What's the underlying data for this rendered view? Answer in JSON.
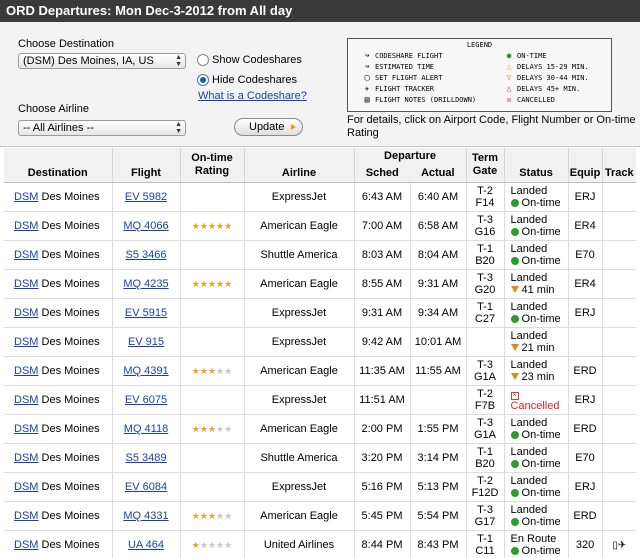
{
  "title": "ORD Departures: Mon Dec-3-2012 from All day",
  "controls": {
    "destination_label": "Choose Destination",
    "destination_value": "(DSM) Des Moines, IA, US",
    "airline_label": "Choose Airline",
    "airline_value": "-- All Airlines --",
    "show_codeshares": "Show Codeshares",
    "hide_codeshares": "Hide Codeshares",
    "codeshare_link": "What is a Codeshare?",
    "update_label": "Update",
    "note": "For details, click on Airport Code, Flight Number or On-time Rating"
  },
  "legend": {
    "title": "LEGEND",
    "items": [
      {
        "symbol": "↝",
        "label": "CODESHARE FLIGHT"
      },
      {
        "symbol": "↝",
        "label": "ESTIMATED TIME"
      },
      {
        "symbol": "▢",
        "label": "SET FLIGHT ALERT"
      },
      {
        "symbol": "✈",
        "label": "FLIGHT TRACKER"
      },
      {
        "symbol": "▤",
        "label": "FLIGHT NOTES (DRILLDOWN)"
      },
      {
        "symbol": "●",
        "label": "ON-TIME"
      },
      {
        "symbol": "△",
        "label": "DELAYS 15-29 MIN."
      },
      {
        "symbol": "▽",
        "label": "DELAYS 30-44 MIN."
      },
      {
        "symbol": "△",
        "label": "DELAYS 45+ MIN."
      },
      {
        "symbol": "☒",
        "label": "CANCELLED"
      }
    ]
  },
  "table": {
    "headers": {
      "destination": "Destination",
      "flight": "Flight",
      "ontime": "On-time Rating",
      "airline": "Airline",
      "departure": "Departure",
      "sched": "Sched",
      "actual": "Actual",
      "term_gate": "Term Gate",
      "status": "Status",
      "equip": "Equip",
      "track": "Track"
    },
    "rows": [
      {
        "code": "DSM",
        "city": "Des Moines",
        "flight": "EV 5982",
        "rating": 0,
        "airline": "ExpressJet",
        "sched": "6:43 AM",
        "actual": "6:40 AM",
        "term": "T-2",
        "gate": "F14",
        "status1": "Landed",
        "status2": "On-time",
        "kind": "ontime",
        "equip": "ERJ",
        "track": ""
      },
      {
        "code": "DSM",
        "city": "Des Moines",
        "flight": "MQ 4066",
        "rating": 5,
        "airline": "American Eagle",
        "sched": "7:00 AM",
        "actual": "6:58 AM",
        "term": "T-3",
        "gate": "G16",
        "status1": "Landed",
        "status2": "On-time",
        "kind": "ontime",
        "equip": "ER4",
        "track": ""
      },
      {
        "code": "DSM",
        "city": "Des Moines",
        "flight": "S5 3466",
        "rating": 0,
        "airline": "Shuttle America",
        "sched": "8:03 AM",
        "actual": "8:04 AM",
        "term": "T-1",
        "gate": "B20",
        "status1": "Landed",
        "status2": "On-time",
        "kind": "ontime",
        "equip": "E70",
        "track": ""
      },
      {
        "code": "DSM",
        "city": "Des Moines",
        "flight": "MQ 4235",
        "rating": 5,
        "airline": "American Eagle",
        "sched": "8:55 AM",
        "actual": "9:31 AM",
        "term": "T-3",
        "gate": "G20",
        "status1": "Landed",
        "status2": "41 min",
        "kind": "delay",
        "equip": "ER4",
        "track": ""
      },
      {
        "code": "DSM",
        "city": "Des Moines",
        "flight": "EV 5915",
        "rating": 0,
        "airline": "ExpressJet",
        "sched": "9:31 AM",
        "actual": "9:34 AM",
        "term": "T-1",
        "gate": "C27",
        "status1": "Landed",
        "status2": "On-time",
        "kind": "ontime",
        "equip": "ERJ",
        "track": ""
      },
      {
        "code": "DSM",
        "city": "Des Moines",
        "flight": "EV 915",
        "rating": 0,
        "airline": "ExpressJet",
        "sched": "9:42 AM",
        "actual": "10:01 AM",
        "term": "",
        "gate": "",
        "status1": "Landed",
        "status2": "21 min",
        "kind": "delay",
        "equip": "",
        "track": ""
      },
      {
        "code": "DSM",
        "city": "Des Moines",
        "flight": "MQ 4391",
        "rating": 3,
        "airline": "American Eagle",
        "sched": "11:35 AM",
        "actual": "11:55 AM",
        "term": "T-3",
        "gate": "G1A",
        "status1": "Landed",
        "status2": "23 min",
        "kind": "delay",
        "equip": "ERD",
        "track": ""
      },
      {
        "code": "DSM",
        "city": "Des Moines",
        "flight": "EV 6075",
        "rating": 0,
        "airline": "ExpressJet",
        "sched": "11:51 AM",
        "actual": "",
        "term": "T-2",
        "gate": "F7B",
        "status1": "Cancelled",
        "status2": "",
        "kind": "cancelled",
        "equip": "ERJ",
        "track": ""
      },
      {
        "code": "DSM",
        "city": "Des Moines",
        "flight": "MQ 4118",
        "rating": 3,
        "airline": "American Eagle",
        "sched": "2:00 PM",
        "actual": "1:55 PM",
        "term": "T-3",
        "gate": "G1A",
        "status1": "Landed",
        "status2": "On-time",
        "kind": "ontime",
        "equip": "ERD",
        "track": ""
      },
      {
        "code": "DSM",
        "city": "Des Moines",
        "flight": "S5 3489",
        "rating": 0,
        "airline": "Shuttle America",
        "sched": "3:20 PM",
        "actual": "3:14 PM",
        "term": "T-1",
        "gate": "B20",
        "status1": "Landed",
        "status2": "On-time",
        "kind": "ontime",
        "equip": "E70",
        "track": ""
      },
      {
        "code": "DSM",
        "city": "Des Moines",
        "flight": "EV 6084",
        "rating": 0,
        "airline": "ExpressJet",
        "sched": "5:16 PM",
        "actual": "5:13 PM",
        "term": "T-2",
        "gate": "F12D",
        "status1": "Landed",
        "status2": "On-time",
        "kind": "ontime",
        "equip": "ERJ",
        "track": ""
      },
      {
        "code": "DSM",
        "city": "Des Moines",
        "flight": "MQ 4331",
        "rating": 3,
        "airline": "American Eagle",
        "sched": "5:45 PM",
        "actual": "5:54 PM",
        "term": "T-3",
        "gate": "G17",
        "status1": "Landed",
        "status2": "On-time",
        "kind": "ontime",
        "equip": "ERD",
        "track": ""
      },
      {
        "code": "DSM",
        "city": "Des Moines",
        "flight": "UA 464",
        "rating": 1,
        "airline": "United Airlines",
        "sched": "8:44 PM",
        "actual": "8:43 PM",
        "term": "T-1",
        "gate": "C11",
        "status1": "En Route",
        "status2": "On-time",
        "kind": "ontime",
        "equip": "320",
        "track": "▯✈"
      }
    ]
  },
  "colors": {
    "title_bg": "#3a3a3a",
    "link": "#1a3fa8",
    "ontime": "#2a9d2a",
    "delay": "#e08a1a",
    "cancelled": "#d22222",
    "star": "#f0a020"
  }
}
